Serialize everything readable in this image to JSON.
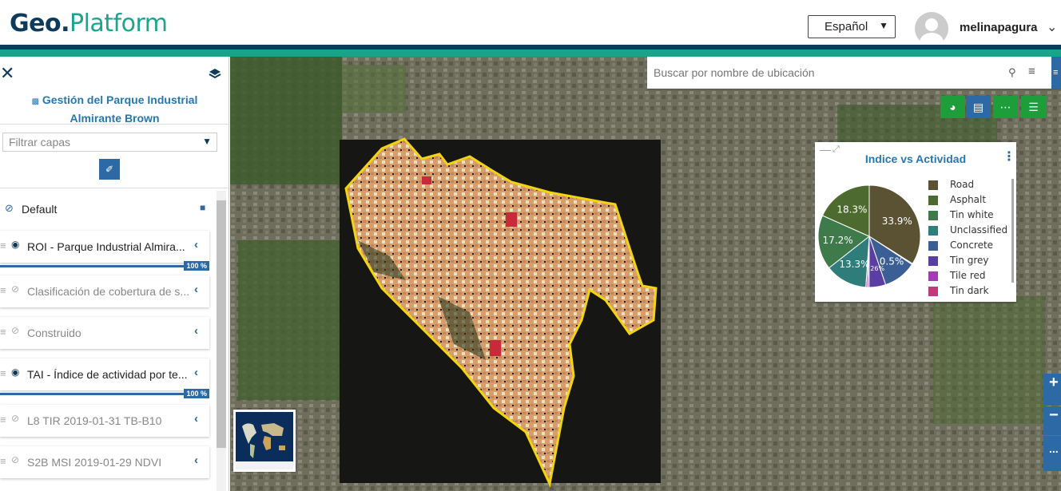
{
  "app": {
    "logo_part1": "Geo.",
    "logo_part2": "Platform",
    "language": "Español",
    "username": "melinapagura"
  },
  "sidebar": {
    "project_title": "Gestión del Parque Industrial Almirante Brown",
    "filter_placeholder": "Filtrar capas",
    "group_label": "Default",
    "layers": [
      {
        "label": "ROI - Parque Industrial Almira...",
        "visible": true,
        "progress": "100 %"
      },
      {
        "label": "Clasificación de cobertura de s...",
        "visible": false
      },
      {
        "label": "Construido",
        "visible": false
      },
      {
        "label": "TAI - Índice de actividad por te...",
        "visible": true,
        "progress": "100 %"
      },
      {
        "label": "L8 TIR 2019-01-31 TB-B10",
        "visible": false
      },
      {
        "label": "S2B MSI 2019-01-29 NDVI",
        "visible": false
      }
    ]
  },
  "map": {
    "search_placeholder": "Buscar por nombre de ubicación",
    "toolbar_icons": [
      "pie-chart-icon",
      "document-icon",
      "more-icon",
      "list-icon"
    ],
    "zoom_in": "+",
    "zoom_out": "−",
    "more": "..."
  },
  "chart_panel": {
    "title": "Indice vs Actividad"
  },
  "colors": {
    "brand_dark": "#0e3a5b",
    "brand_teal": "#17a589",
    "accent_blue": "#2d6aa5",
    "toolbar_green": "#1e9e3a"
  },
  "chart_data": {
    "type": "pie",
    "title": "Indice vs Actividad",
    "legend_position": "right",
    "slices": [
      {
        "name": "Road",
        "value": 33.9,
        "label": "33.9%",
        "color": "#5a5233"
      },
      {
        "name": "Asphalt",
        "value": 0.3,
        "label": "",
        "color": "#4e6b2f"
      },
      {
        "name": "Tin white",
        "value": 0.0,
        "label": "",
        "color": "#3f7a4a"
      },
      {
        "name": "Unclassified",
        "value": 0.0,
        "label": "",
        "color": "#2f7d7a"
      },
      {
        "name": "Concrete",
        "value": 10.5,
        "label": "10.5%",
        "color": "#3b5f95"
      },
      {
        "name": "Tin grey",
        "value": 5.26,
        "label": "5.26%",
        "color": "#5a3ea6"
      },
      {
        "name": "Tile red",
        "value": 0.5,
        "label": "",
        "color": "#a33cb3"
      },
      {
        "name": "Tin dark",
        "value": 0.5,
        "label": "",
        "color": "#c0397a"
      },
      {
        "name": "Slice 13.3",
        "value": 13.3,
        "label": "13.3%",
        "color": "#2f7d7a"
      },
      {
        "name": "Slice 17.2",
        "value": 17.2,
        "label": "17.2%",
        "color": "#3f7a4a"
      },
      {
        "name": "Slice 18.3",
        "value": 18.3,
        "label": "18.3%",
        "color": "#4e6b2f"
      }
    ],
    "legend": [
      {
        "name": "Road",
        "color": "#5a5233"
      },
      {
        "name": "Asphalt",
        "color": "#4e6b2f"
      },
      {
        "name": "Tin white",
        "color": "#3f7a4a"
      },
      {
        "name": "Unclassified",
        "color": "#2f7d7a"
      },
      {
        "name": "Concrete",
        "color": "#3b5f95"
      },
      {
        "name": "Tin grey",
        "color": "#5a3ea6"
      },
      {
        "name": "Tile red",
        "color": "#a33cb3"
      },
      {
        "name": "Tin dark",
        "color": "#c0397a"
      }
    ]
  }
}
